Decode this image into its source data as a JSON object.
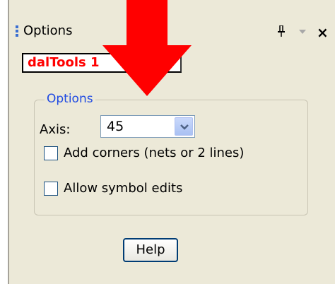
{
  "panel": {
    "title": "Options",
    "product_label": "dalTools 1",
    "group_title": "Options",
    "axis": {
      "label": "Axis:",
      "value": "45"
    },
    "checkboxes": [
      {
        "label": "Add corners (nets or 2 lines)",
        "checked": false
      },
      {
        "label": "Allow symbol edits",
        "checked": false
      }
    ],
    "help_label": "Help"
  },
  "icons": {
    "grip": "grip-icon",
    "pin": "pin-icon",
    "dropdown": "chevron-down-icon",
    "close": "close-icon",
    "annotation": "red-arrow-icon"
  },
  "colors": {
    "panel_bg": "#ece9d8",
    "group_title": "#1f4ae2",
    "product_label_text": "#ff0000",
    "annotation_arrow": "#ff0000"
  }
}
